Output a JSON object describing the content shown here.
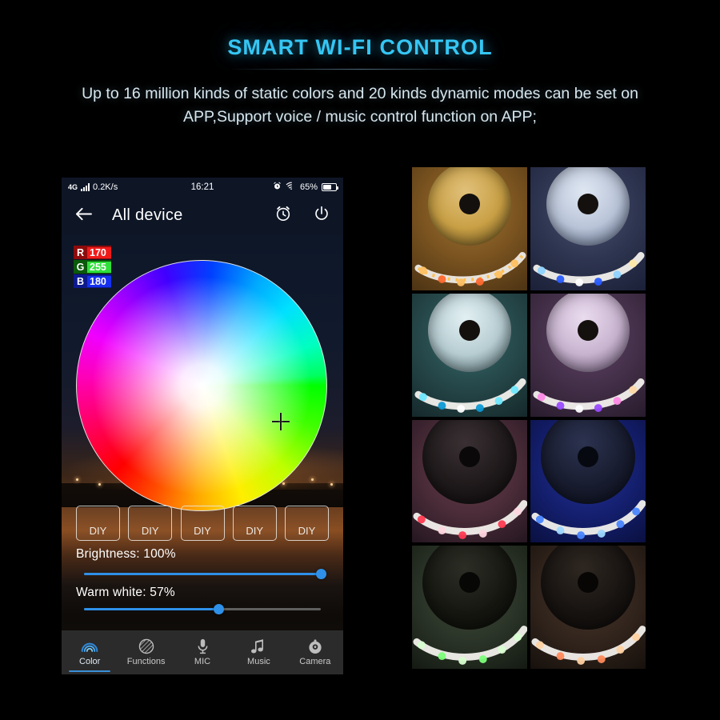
{
  "hero": {
    "title": "SMART WI-FI CONTROL",
    "subtitle": "Up to 16 million kinds of static colors and 20 kinds dynamic modes can be set on APP,Support voice / music control function on APP;",
    "title_color": "#35c6f4",
    "subtitle_color": "#d6e7ef"
  },
  "phone": {
    "status_bar": {
      "network": "4G",
      "data_rate": "0.2K/s",
      "time": "16:21",
      "battery_percent": "65%",
      "icons": [
        "signal-bars-icon",
        "alarm-clock-icon",
        "wifi-icon",
        "battery-icon"
      ]
    },
    "app_bar": {
      "back_icon": "arrow-left-icon",
      "title": "All device",
      "timer_icon": "alarm-timer-icon",
      "power_icon": "power-icon"
    },
    "color_picker": {
      "r_key": "R",
      "r_value": "170",
      "g_key": "G",
      "g_value": "255",
      "b_key": "B",
      "b_value": "180",
      "r_color": "#ef1b1b",
      "g_color": "#2fe03a",
      "b_color": "#1531ef",
      "selector_icon": "crosshair-icon"
    },
    "presets": [
      {
        "label": "DIY"
      },
      {
        "label": "DIY"
      },
      {
        "label": "DIY"
      },
      {
        "label": "DIY"
      },
      {
        "label": "DIY"
      }
    ],
    "sliders": [
      {
        "label": "Brightness: 100%",
        "value": 100,
        "accent": "#2e90e8"
      },
      {
        "label": "Warm white: 57%",
        "value": 57,
        "accent": "#2e90e8"
      }
    ],
    "bottom_nav": {
      "active_index": 0,
      "accent": "#3a8fd8",
      "items": [
        {
          "label": "Color",
          "icon": "rainbow-icon"
        },
        {
          "label": "Functions",
          "icon": "hatched-circle-icon"
        },
        {
          "label": "MIC",
          "icon": "microphone-icon"
        },
        {
          "label": "Music",
          "icon": "music-note-icon"
        },
        {
          "label": "Camera",
          "icon": "camera-icon"
        }
      ]
    }
  },
  "gallery": {
    "caption_alt": "LED strip reel color samples",
    "cells": [
      {
        "name": "warm-amber-reel",
        "bg": "#7b5420",
        "reel": "#c9a045",
        "led_a": "#ffbe4a",
        "led_b": "#ff6a30",
        "strip_glow": "#ffc061"
      },
      {
        "name": "blue-white-reel",
        "bg": "#2e3550",
        "reel": "#b9c4d8",
        "led_a": "#7fd0ff",
        "led_b": "#2a5cff",
        "strip_glow": "#8fd3ff"
      },
      {
        "name": "cyan-teal-reel",
        "bg": "#26484a",
        "reel": "#b7cdd2",
        "led_a": "#49e6ff",
        "led_b": "#0f9bd6",
        "strip_glow": "#6fe8ff"
      },
      {
        "name": "magenta-violet-reel",
        "bg": "#443049",
        "reel": "#c8b3cf",
        "led_a": "#ff78e6",
        "led_b": "#9a4cff",
        "strip_glow": "#ff8ae6"
      },
      {
        "name": "red-pink-reel",
        "bg": "#4a2c38",
        "reel": "#1c1718",
        "led_a": "#ff3b52",
        "led_b": "#ffd7e0",
        "strip_glow": "#ff5f74"
      },
      {
        "name": "deep-blue-reel",
        "bg": "#141f6e",
        "reel": "#161a2c",
        "led_a": "#3f7bff",
        "led_b": "#9fd8ff",
        "strip_glow": "#4a86ff"
      },
      {
        "name": "white-green-reel",
        "bg": "#2a3327",
        "reel": "#14150f",
        "led_a": "#d8ffd0",
        "led_b": "#7cff7a",
        "strip_glow": "#cffbc9"
      },
      {
        "name": "warm-multicolor-reel",
        "bg": "#31241c",
        "reel": "#161210",
        "led_a": "#ffd9a8",
        "led_b": "#ff8b5c",
        "strip_glow": "#ffd2a2"
      }
    ]
  }
}
